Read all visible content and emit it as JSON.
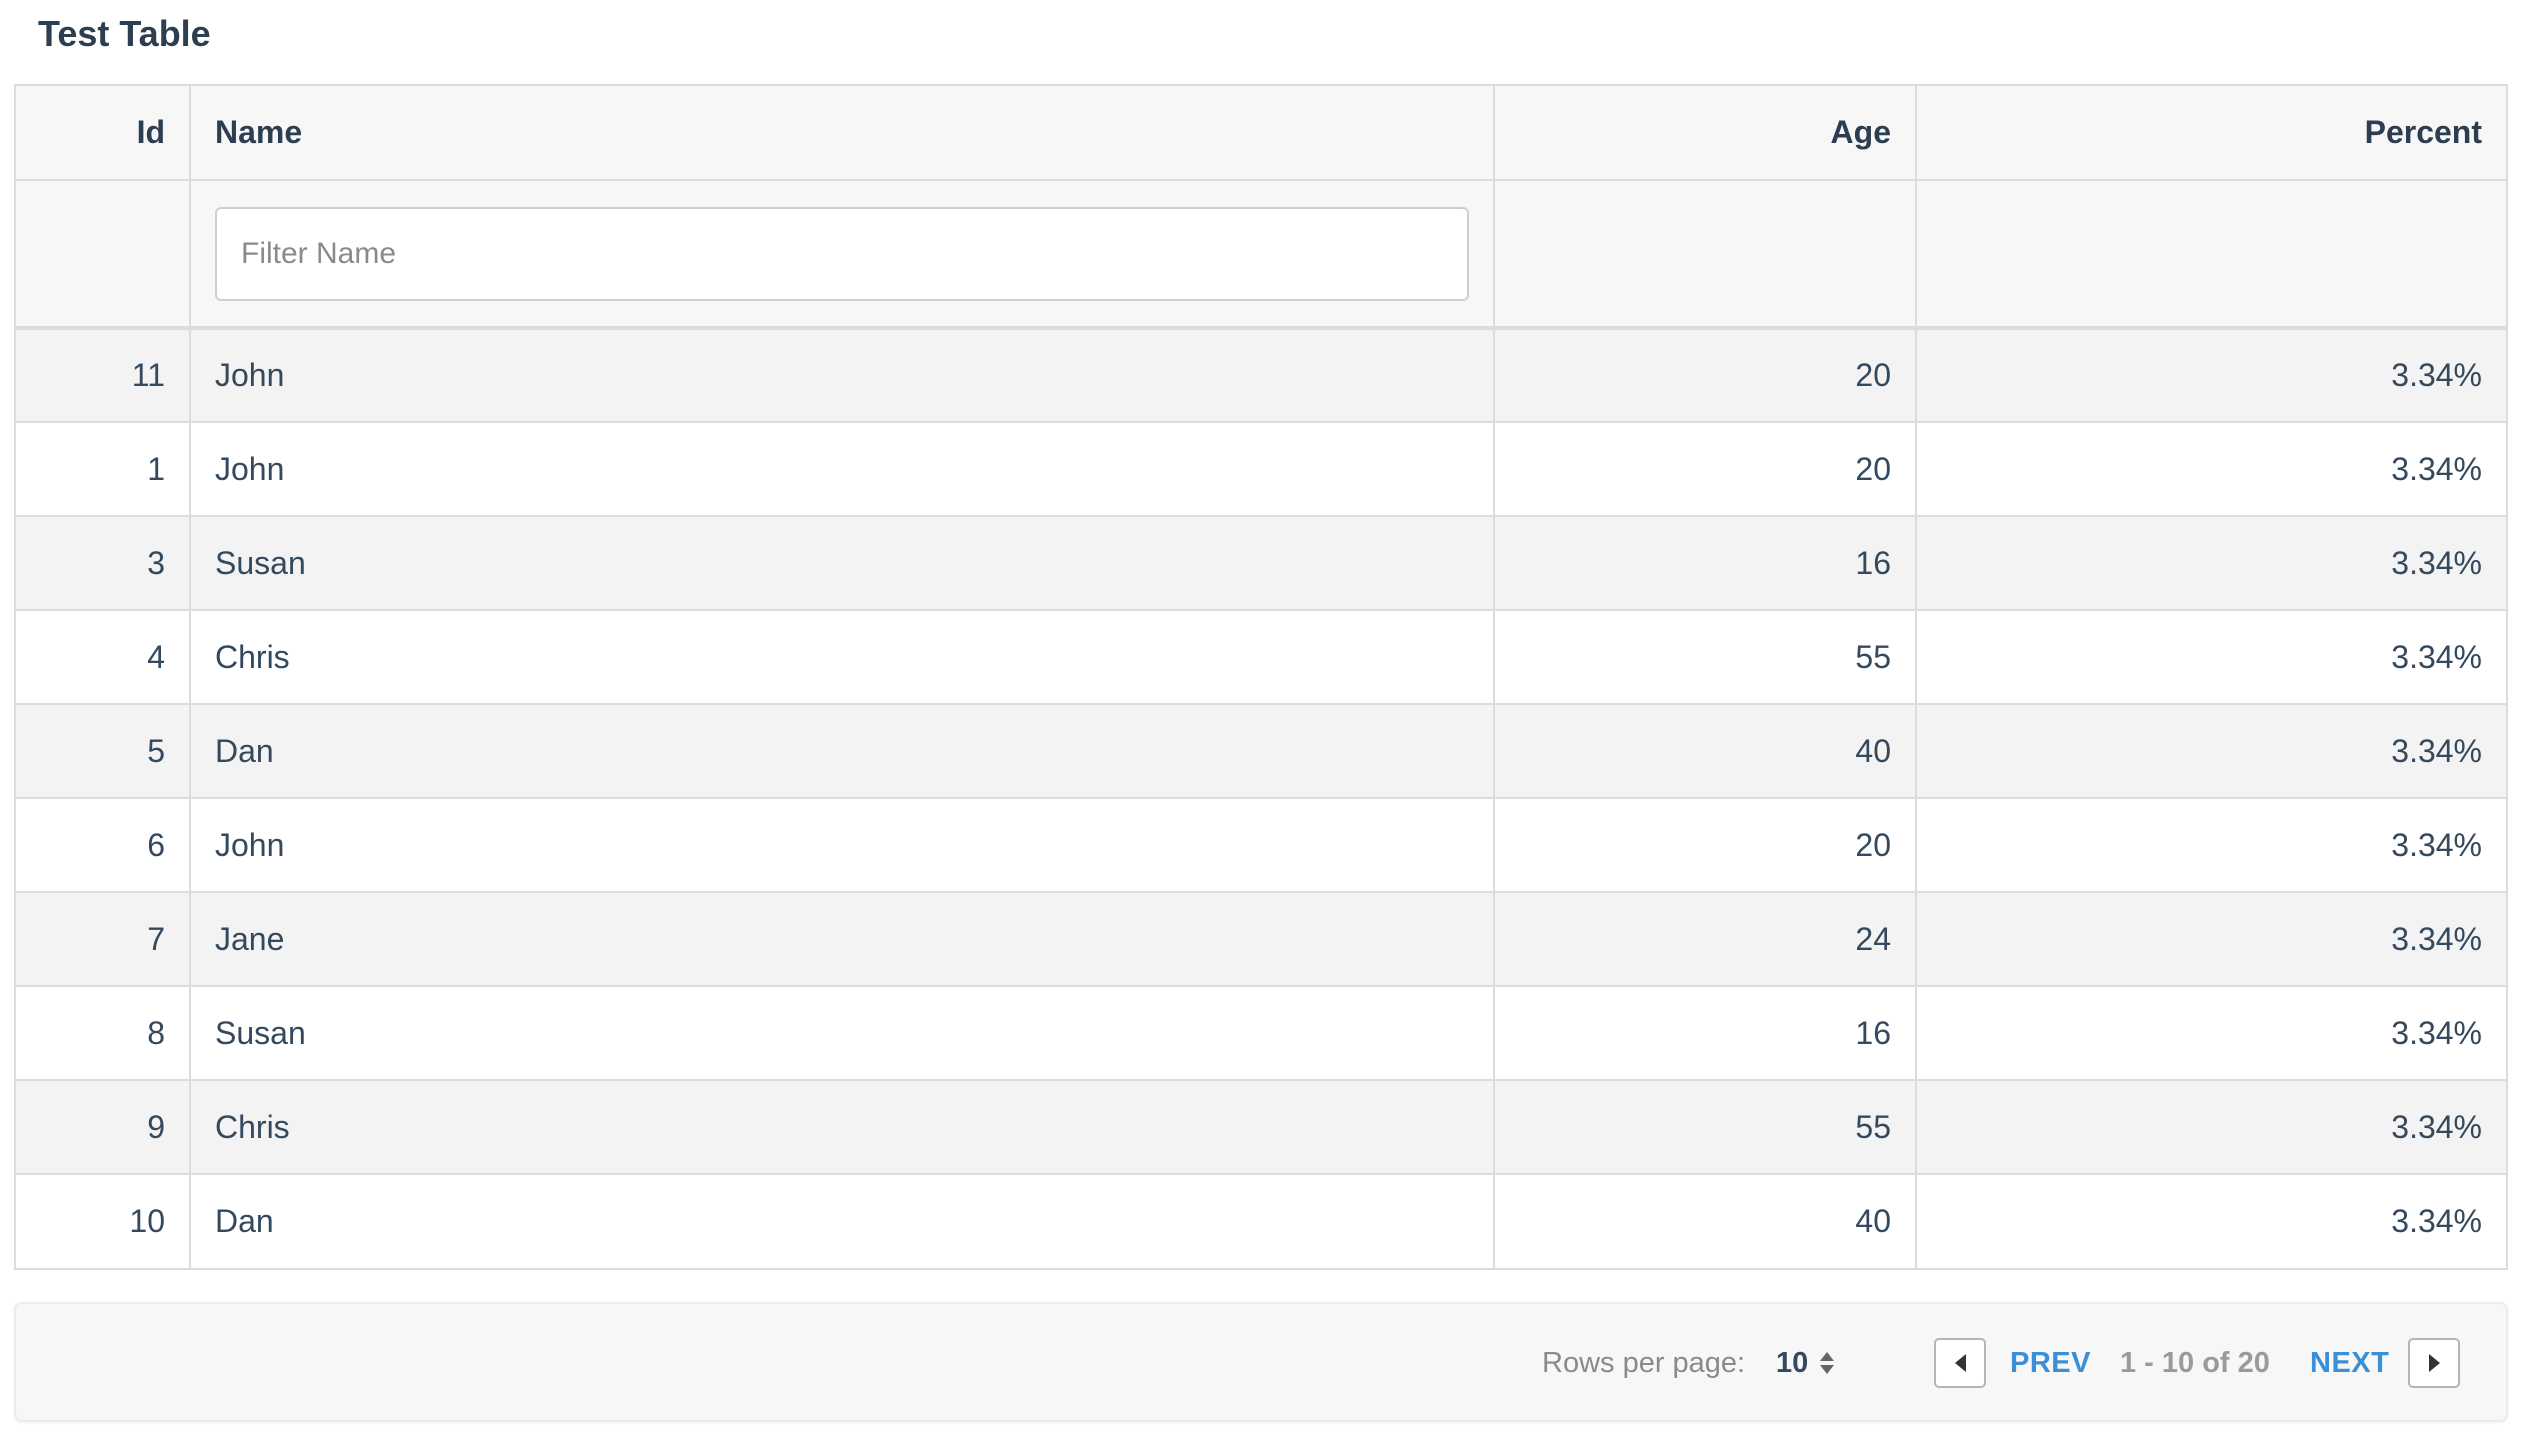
{
  "page": {
    "title": "Test Table"
  },
  "table": {
    "columns": {
      "id": "Id",
      "name": "Name",
      "age": "Age",
      "percent": "Percent"
    },
    "filter": {
      "name_placeholder": "Filter Name",
      "name_value": ""
    },
    "rows": [
      {
        "id": "11",
        "name": "John",
        "age": "20",
        "percent": "3.34%"
      },
      {
        "id": "1",
        "name": "John",
        "age": "20",
        "percent": "3.34%"
      },
      {
        "id": "3",
        "name": "Susan",
        "age": "16",
        "percent": "3.34%"
      },
      {
        "id": "4",
        "name": "Chris",
        "age": "55",
        "percent": "3.34%"
      },
      {
        "id": "5",
        "name": "Dan",
        "age": "40",
        "percent": "3.34%"
      },
      {
        "id": "6",
        "name": "John",
        "age": "20",
        "percent": "3.34%"
      },
      {
        "id": "7",
        "name": "Jane",
        "age": "24",
        "percent": "3.34%"
      },
      {
        "id": "8",
        "name": "Susan",
        "age": "16",
        "percent": "3.34%"
      },
      {
        "id": "9",
        "name": "Chris",
        "age": "55",
        "percent": "3.34%"
      },
      {
        "id": "10",
        "name": "Dan",
        "age": "40",
        "percent": "3.34%"
      }
    ]
  },
  "pagination": {
    "rows_per_page_label": "Rows per page:",
    "rows_per_page_value": "10",
    "prev_label": "PREV",
    "next_label": "NEXT",
    "range_text": "1 - 10 of 20",
    "prev_icon": "caret-left-icon",
    "next_icon": "caret-right-icon",
    "select_icon": "sort-arrows-icon"
  },
  "colors": {
    "link": "#3a8fd6",
    "header_bg": "#f7f7f7",
    "stripe_bg": "#f3f3f3",
    "text": "#34495e"
  }
}
